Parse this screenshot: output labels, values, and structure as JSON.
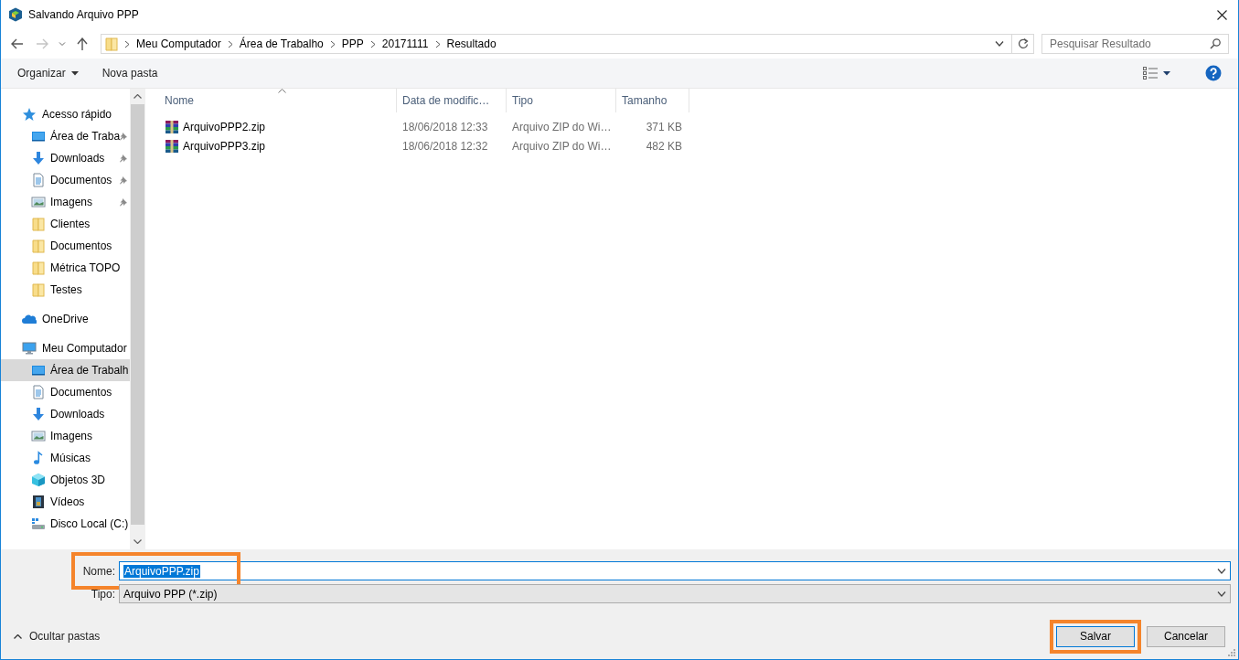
{
  "window": {
    "title": "Salvando Arquivo PPP"
  },
  "navigation": {
    "back": {
      "disabled": false
    },
    "forward": {
      "disabled": true
    }
  },
  "address": {
    "path": [
      "Meu Computador",
      "Área de Trabalho",
      "PPP",
      "20171111",
      "Resultado"
    ]
  },
  "search": {
    "placeholder": "Pesquisar Resultado"
  },
  "toolbar": {
    "organize": "Organizar",
    "new_folder": "Nova pasta"
  },
  "sidebar": {
    "items": [
      {
        "label": "Acesso rápido",
        "kind": "star",
        "selected": false,
        "children": [
          {
            "label": "Área de Traba",
            "kind": "monitor",
            "pinned": true,
            "selected": false
          },
          {
            "label": "Downloads",
            "kind": "download",
            "pinned": true,
            "selected": false
          },
          {
            "label": "Documentos",
            "kind": "document",
            "pinned": true,
            "selected": false
          },
          {
            "label": "Imagens",
            "kind": "image",
            "pinned": true,
            "selected": false
          },
          {
            "label": "Clientes",
            "kind": "folder",
            "pinned": false,
            "selected": false
          },
          {
            "label": "Documentos",
            "kind": "folder",
            "pinned": false,
            "selected": false
          },
          {
            "label": "Métrica TOPO",
            "kind": "folder",
            "pinned": false,
            "selected": false
          },
          {
            "label": "Testes",
            "kind": "folder",
            "pinned": false,
            "selected": false
          }
        ]
      },
      {
        "label": "OneDrive",
        "kind": "cloud",
        "selected": false
      },
      {
        "label": "Meu Computador",
        "kind": "computer",
        "selected": false,
        "children": [
          {
            "label": "Área de Trabalh",
            "kind": "monitor",
            "selected": true
          },
          {
            "label": "Documentos",
            "kind": "document",
            "selected": false
          },
          {
            "label": "Downloads",
            "kind": "download",
            "selected": false
          },
          {
            "label": "Imagens",
            "kind": "image",
            "selected": false
          },
          {
            "label": "Músicas",
            "kind": "music",
            "selected": false
          },
          {
            "label": "Objetos 3D",
            "kind": "cube",
            "selected": false
          },
          {
            "label": "Vídeos",
            "kind": "video",
            "selected": false
          },
          {
            "label": "Disco Local (C:)",
            "kind": "drive",
            "selected": false
          }
        ]
      }
    ]
  },
  "files": {
    "columns": [
      {
        "label": "Nome",
        "sorted": true
      },
      {
        "label": "Data de modific…",
        "sorted": false
      },
      {
        "label": "Tipo",
        "sorted": false
      },
      {
        "label": "Tamanho",
        "sorted": false
      }
    ],
    "rows": [
      {
        "name": "ArquivoPPP2.zip",
        "modified": "18/06/2018 12:33",
        "type": "Arquivo ZIP do Wi…",
        "size": "371 KB"
      },
      {
        "name": "ArquivoPPP3.zip",
        "modified": "18/06/2018 12:32",
        "type": "Arquivo ZIP do Wi…",
        "size": "482 KB"
      }
    ]
  },
  "filename": {
    "label": "Nome:",
    "value": "ArquivoPPP.zip",
    "text_selected": true,
    "highlighted": true
  },
  "filetype": {
    "label": "Tipo:",
    "value": "Arquivo PPP (*.zip)"
  },
  "hide_folders": "Ocultar pastas",
  "buttons": [
    {
      "label": "Salvar",
      "kind": "primary",
      "highlighted": true
    },
    {
      "label": "Cancelar",
      "kind": "default",
      "highlighted": false
    }
  ]
}
